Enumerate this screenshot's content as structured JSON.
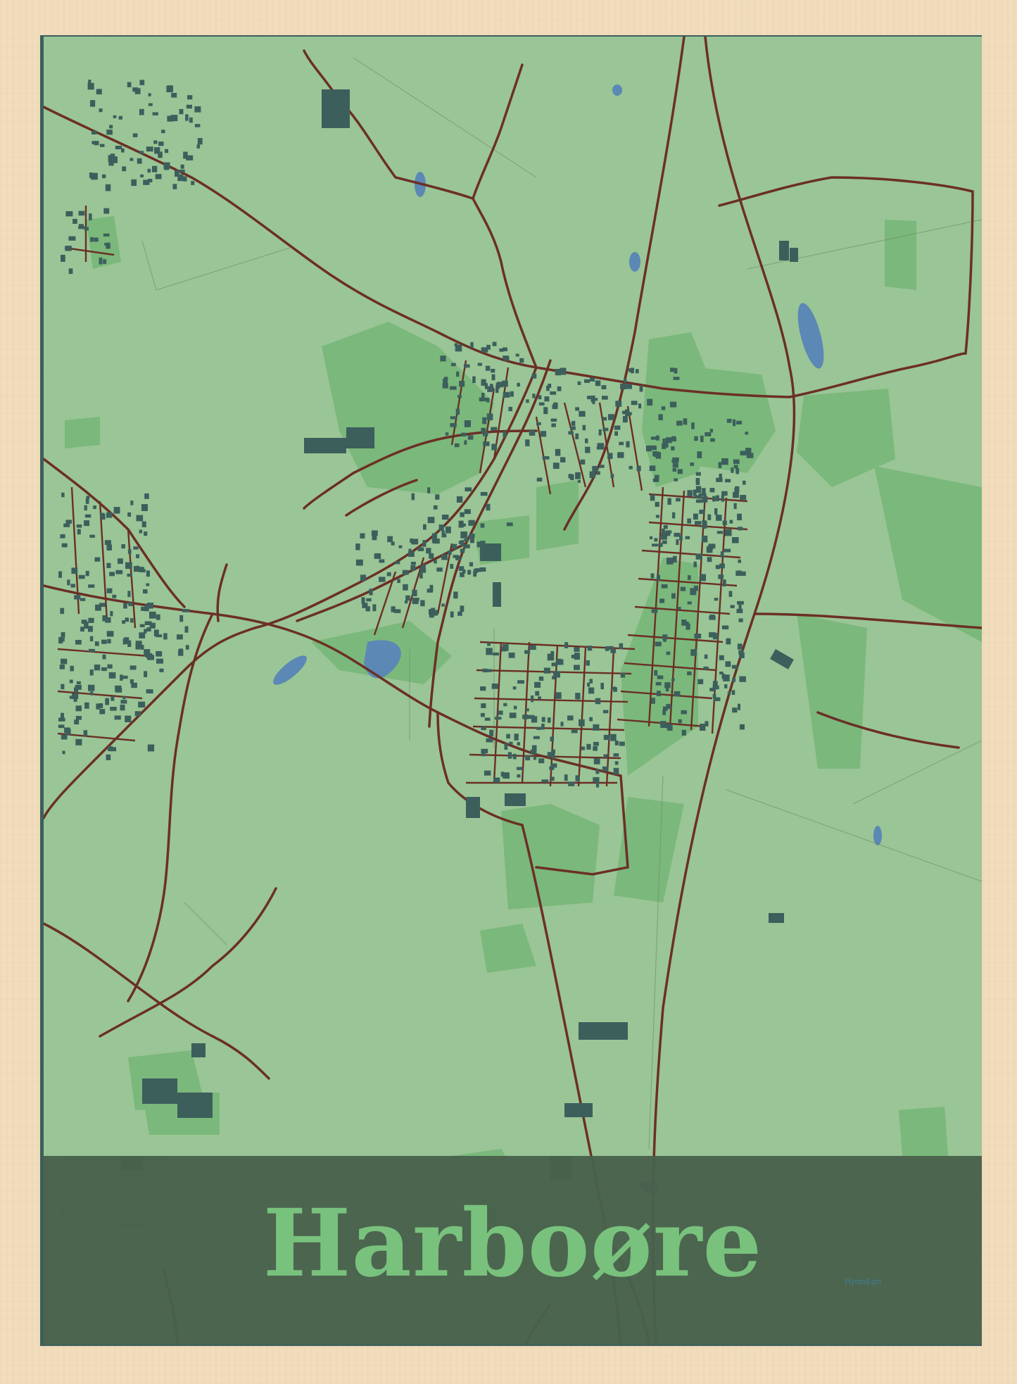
{
  "poster": {
    "city_name": "Harboøre",
    "brand": "HjemEgn"
  },
  "colors": {
    "frame": "#f1dcbc",
    "land": "#9ac596",
    "park": "#7bb87b",
    "water": "#5b88b5",
    "buildings": "#3c5f5c",
    "roads": "#6b2f26",
    "band": "#49614b",
    "title": "#78c27e"
  },
  "icons": {
    "water_bodies": "blue-ellipse-shapes",
    "buildings": "dark-rect-blocks"
  }
}
